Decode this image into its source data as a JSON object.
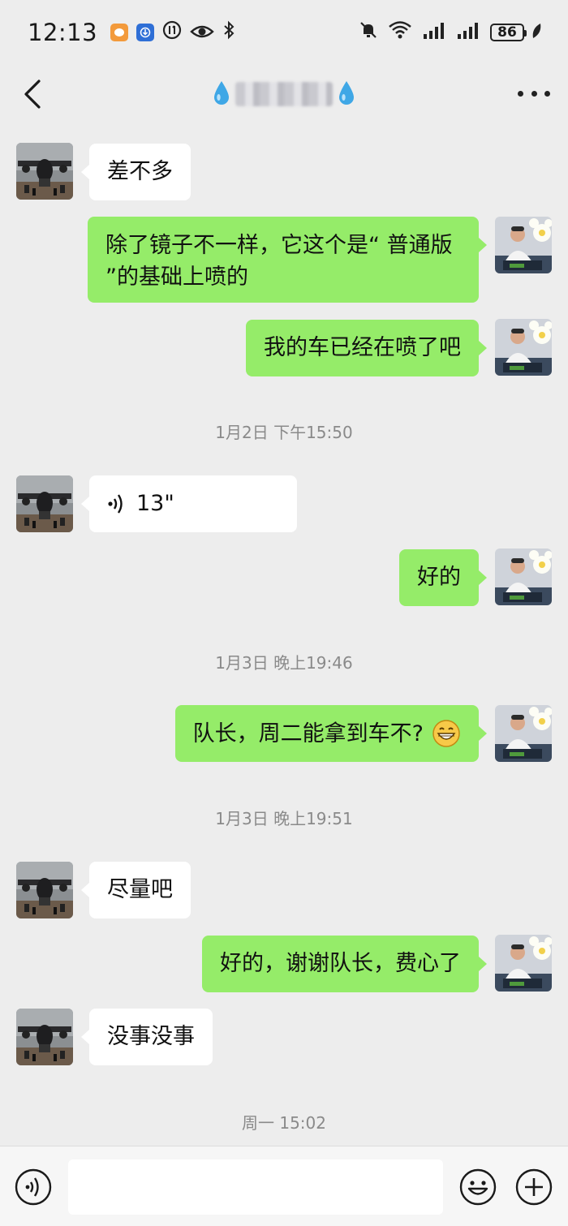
{
  "status_bar": {
    "time": "12:13",
    "battery": "86",
    "icons": [
      "app-notification-icon",
      "app-download-icon",
      "data-saver-icon",
      "eye-icon",
      "bluetooth-icon",
      "mute-icon",
      "wifi-icon",
      "signal-icon",
      "signal-icon",
      "battery-icon",
      "leaf-icon"
    ]
  },
  "header": {
    "back_icon": "chevron-left-icon",
    "title_prefix_icon": "droplet-icon",
    "title_suffix_icon": "droplet-icon",
    "more_icon": "more-horizontal-icon"
  },
  "messages": [
    {
      "side": "in",
      "text": "差不多"
    },
    {
      "side": "out",
      "text": "除了镜子不一样，它这个是“ 普通版 ”的基础上喷的"
    },
    {
      "side": "out",
      "text": "我的车已经在喷了吧"
    },
    {
      "type": "time",
      "text": "1月2日 下午15:50"
    },
    {
      "side": "in",
      "type": "voice",
      "text": "13\""
    },
    {
      "side": "out",
      "text": "好的"
    },
    {
      "type": "time",
      "text": "1月3日 晚上19:46"
    },
    {
      "side": "out",
      "text": "队长，周二能拿到车不?",
      "emoji": "grinning-face"
    },
    {
      "type": "time",
      "text": "1月3日 晚上19:51"
    },
    {
      "side": "in",
      "text": "尽量吧"
    },
    {
      "side": "out",
      "text": "好的，谢谢队长，费心了"
    },
    {
      "side": "in",
      "text": "没事没事"
    },
    {
      "type": "time",
      "text": "周一 15:02"
    }
  ],
  "input_bar": {
    "value": "",
    "voice_icon": "voice-toggle-icon",
    "emoji_icon": "emoji-icon",
    "plus_icon": "plus-icon"
  },
  "colors": {
    "background": "#ededed",
    "bubble_out": "#95ec69",
    "bubble_in": "#ffffff",
    "timestamp": "#8a8a8a"
  }
}
